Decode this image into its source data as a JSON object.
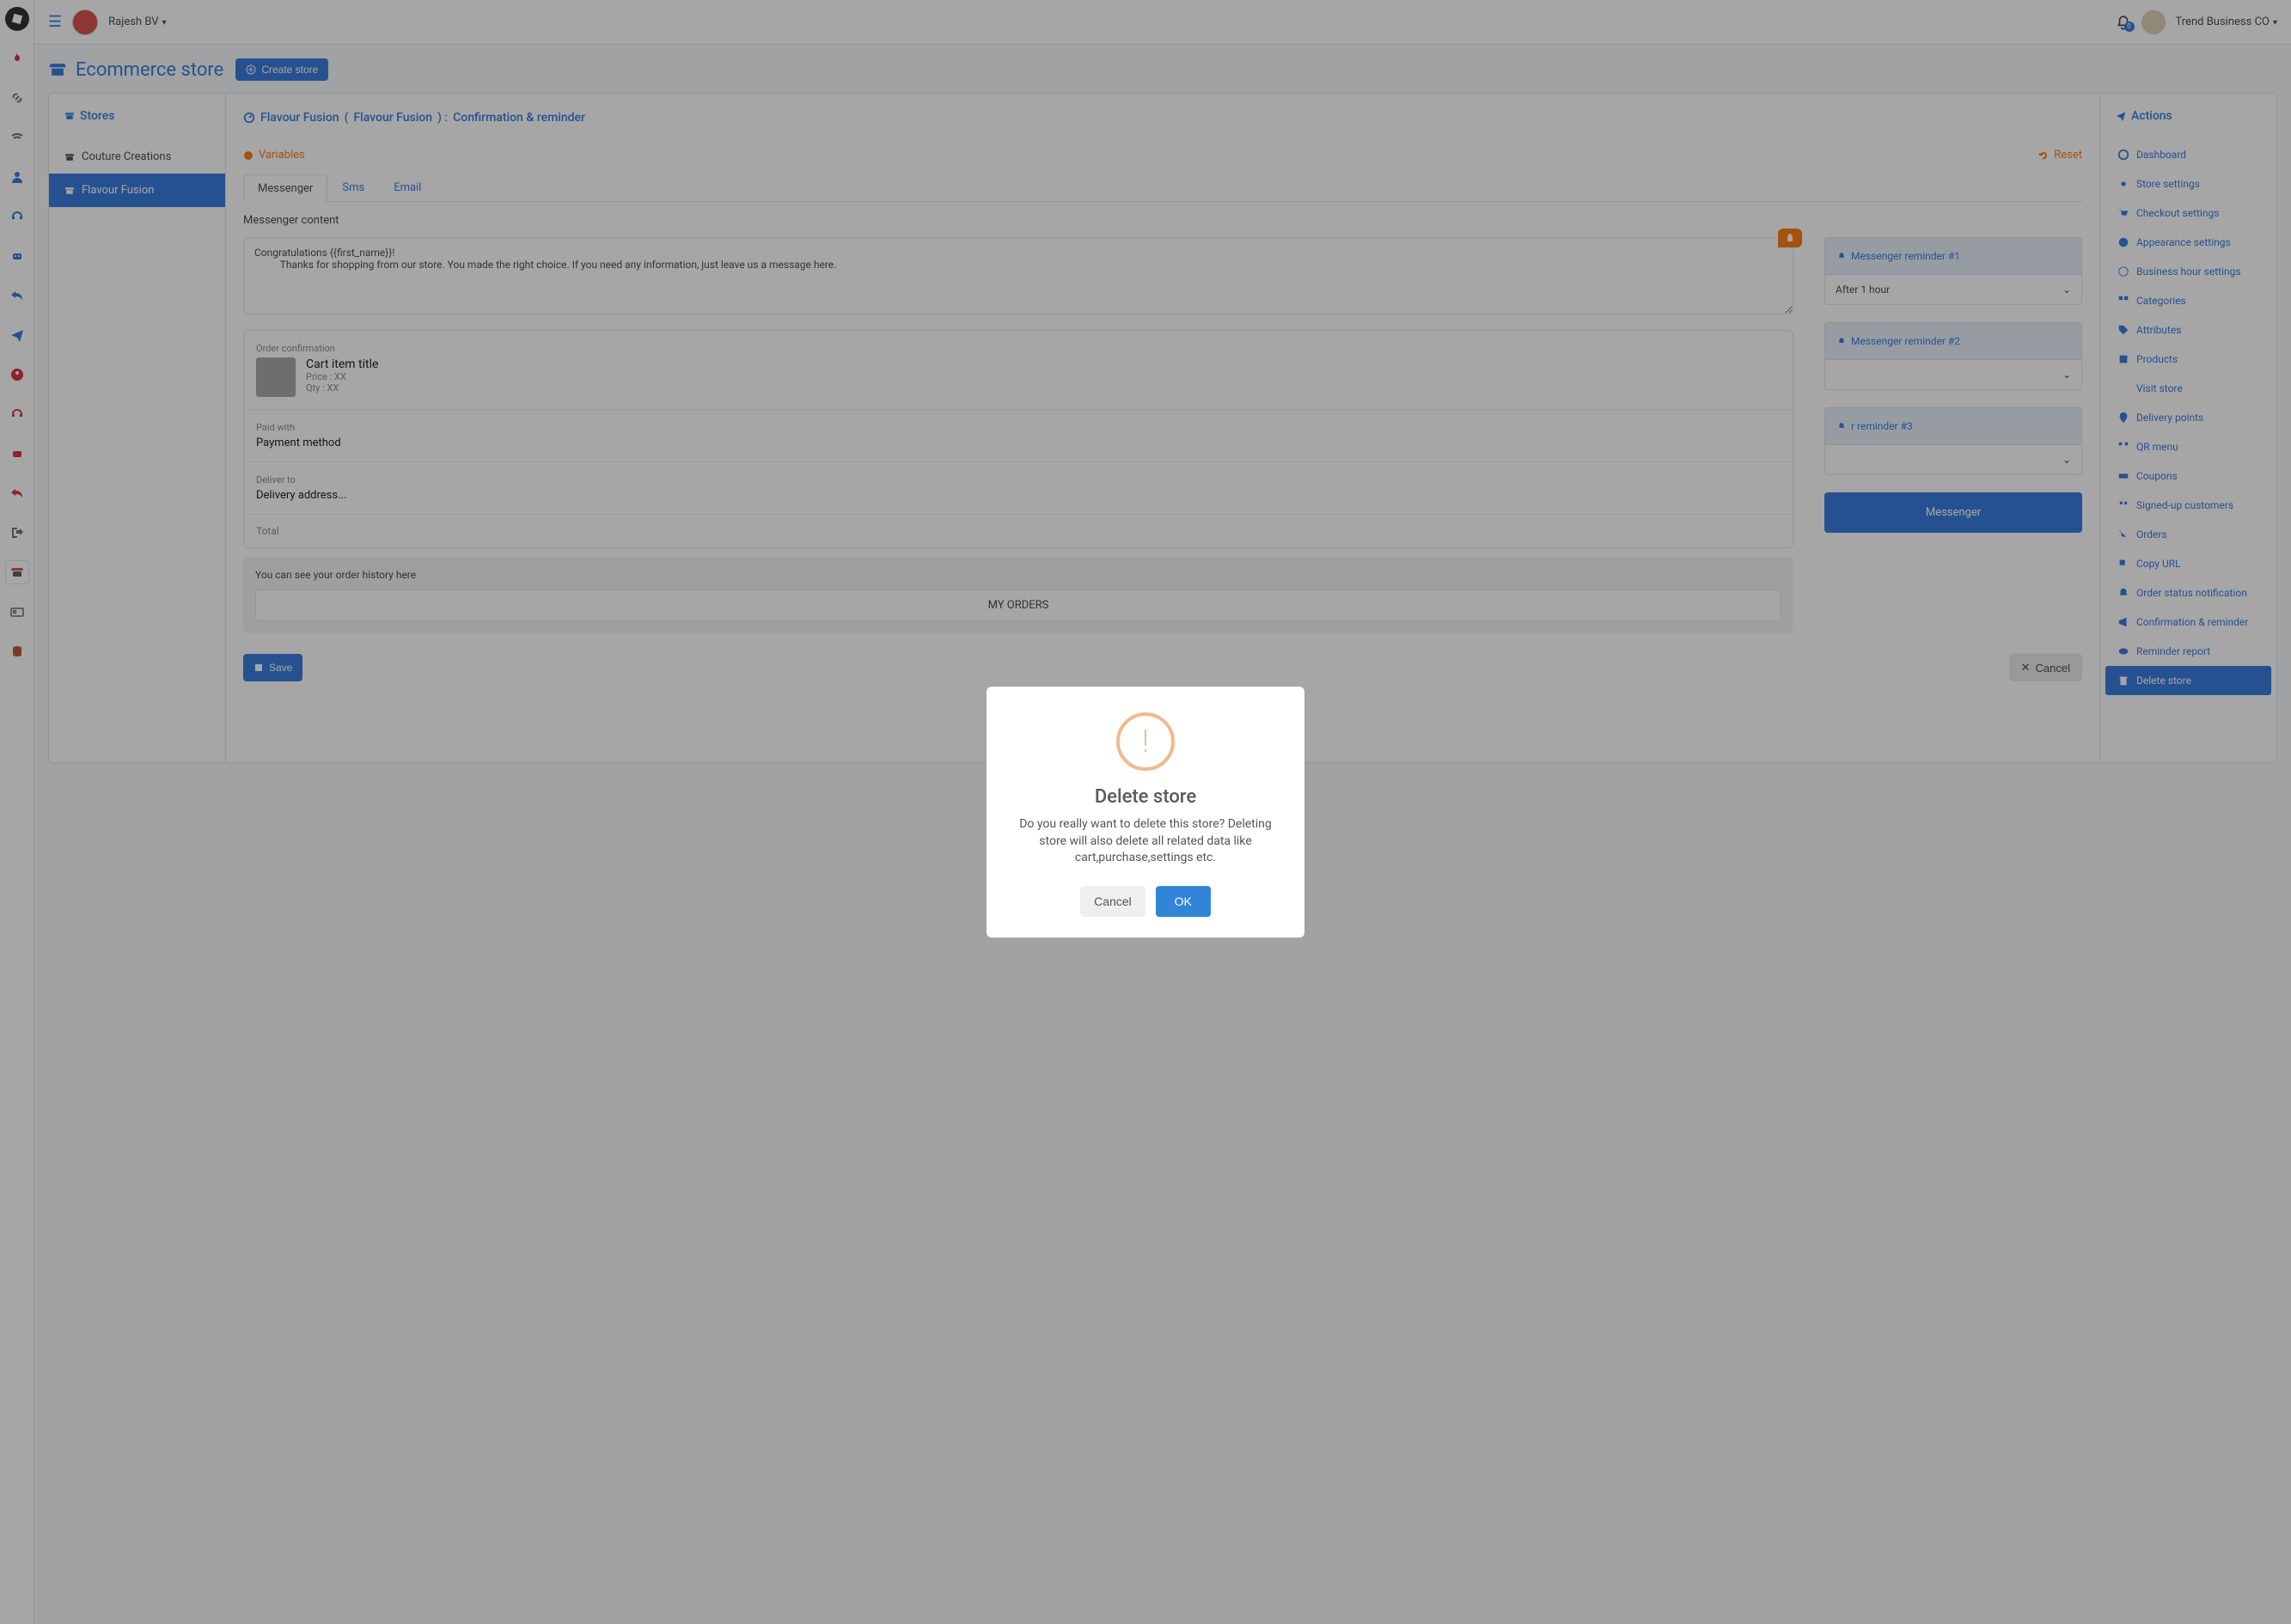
{
  "topbar": {
    "user_name": "Rajesh BV",
    "business_name": "Trend Business CO",
    "notification_count": "0"
  },
  "page": {
    "title": "Ecommerce store",
    "create_button": "Create store"
  },
  "stores": {
    "heading": "Stores",
    "items": [
      {
        "label": "Couture Creations"
      },
      {
        "label": "Flavour Fusion"
      }
    ]
  },
  "breadcrumb": {
    "store": "Flavour Fusion",
    "bot": "Flavour Fusion",
    "section": "Confirmation & reminder"
  },
  "vars": {
    "label": "Variables",
    "reset": "Reset"
  },
  "tabs": {
    "messenger": "Messenger",
    "sms": "Sms",
    "email": "Email"
  },
  "messenger": {
    "content_label": "Messenger content",
    "text_value": "Congratulations {{first_name}}!\n          Thanks for shopping from our store. You made the right choice. If you need any information, just leave us a message here.",
    "order_confirmation_label": "Order confirmation",
    "cart_item_title": "Cart item title",
    "price": "Price : XX",
    "qty": "Qty : XX",
    "paid_with_label": "Paid with",
    "payment_method": "Payment method",
    "deliver_to_label": "Deliver to",
    "delivery_address": "Delivery address...",
    "total_label": "Total",
    "history_text": "You can see your order history here",
    "my_orders": "MY ORDERS"
  },
  "reminders": {
    "r1": "Messenger reminder #1",
    "r1_after": "After 1 hour",
    "r2": "Messenger reminder #2",
    "r3": "r reminder #3",
    "add_more": "Messenger"
  },
  "footer": {
    "save": "Save",
    "cancel": "Cancel"
  },
  "actions": {
    "heading": "Actions",
    "items": [
      "Dashboard",
      "Store settings",
      "Checkout settings",
      "Appearance settings",
      "Business hour settings",
      "Categories",
      "Attributes",
      "Products",
      "Visit store",
      "Delivery points",
      "QR menu",
      "Coupons",
      "Signed-up customers",
      "Orders",
      "Copy URL",
      "Order status notification",
      "Confirmation & reminder",
      "Reminder report",
      "Delete store"
    ]
  },
  "modal": {
    "title": "Delete store",
    "text": "Do you really want to delete this store? Deleting store will also delete all related data like cart,purchase,settings etc.",
    "cancel": "Cancel",
    "ok": "OK"
  }
}
